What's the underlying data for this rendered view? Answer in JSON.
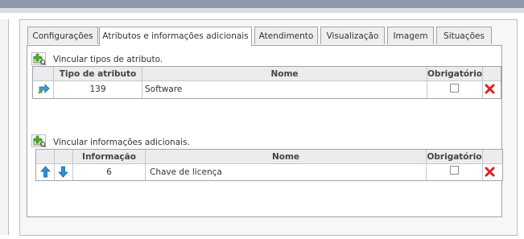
{
  "tabs": [
    {
      "label": "Configurações",
      "active": false
    },
    {
      "label": "Atributos e informações adicionais",
      "active": true
    },
    {
      "label": "Atendimento",
      "active": false
    },
    {
      "label": "Visualização",
      "active": false
    },
    {
      "label": "Imagem",
      "active": false
    },
    {
      "label": "Situações",
      "active": false
    }
  ],
  "attributes": {
    "link_label": "Vincular tipos de atributo.",
    "columns": {
      "type": "Tipo de atributo",
      "name": "Nome",
      "required": "Obrigatório"
    },
    "rows": [
      {
        "type": "139",
        "name": "Software",
        "required": false
      }
    ]
  },
  "additional": {
    "link_label": "Vincular informações adicionais.",
    "columns": {
      "info": "Informação",
      "name": "Nome",
      "required": "Obrigatório"
    },
    "rows": [
      {
        "info": "6",
        "name": "Chave de licença",
        "required": false
      }
    ]
  },
  "icons": {
    "add": "add-link-icon",
    "edit": "edit-arrow-icon",
    "delete": "delete-x-icon",
    "up": "arrow-up-icon",
    "down": "arrow-down-icon"
  },
  "colors": {
    "delete_red": "#e02020",
    "arrow_blue": "#2f8fd8",
    "add_green": "#4caf2a"
  }
}
